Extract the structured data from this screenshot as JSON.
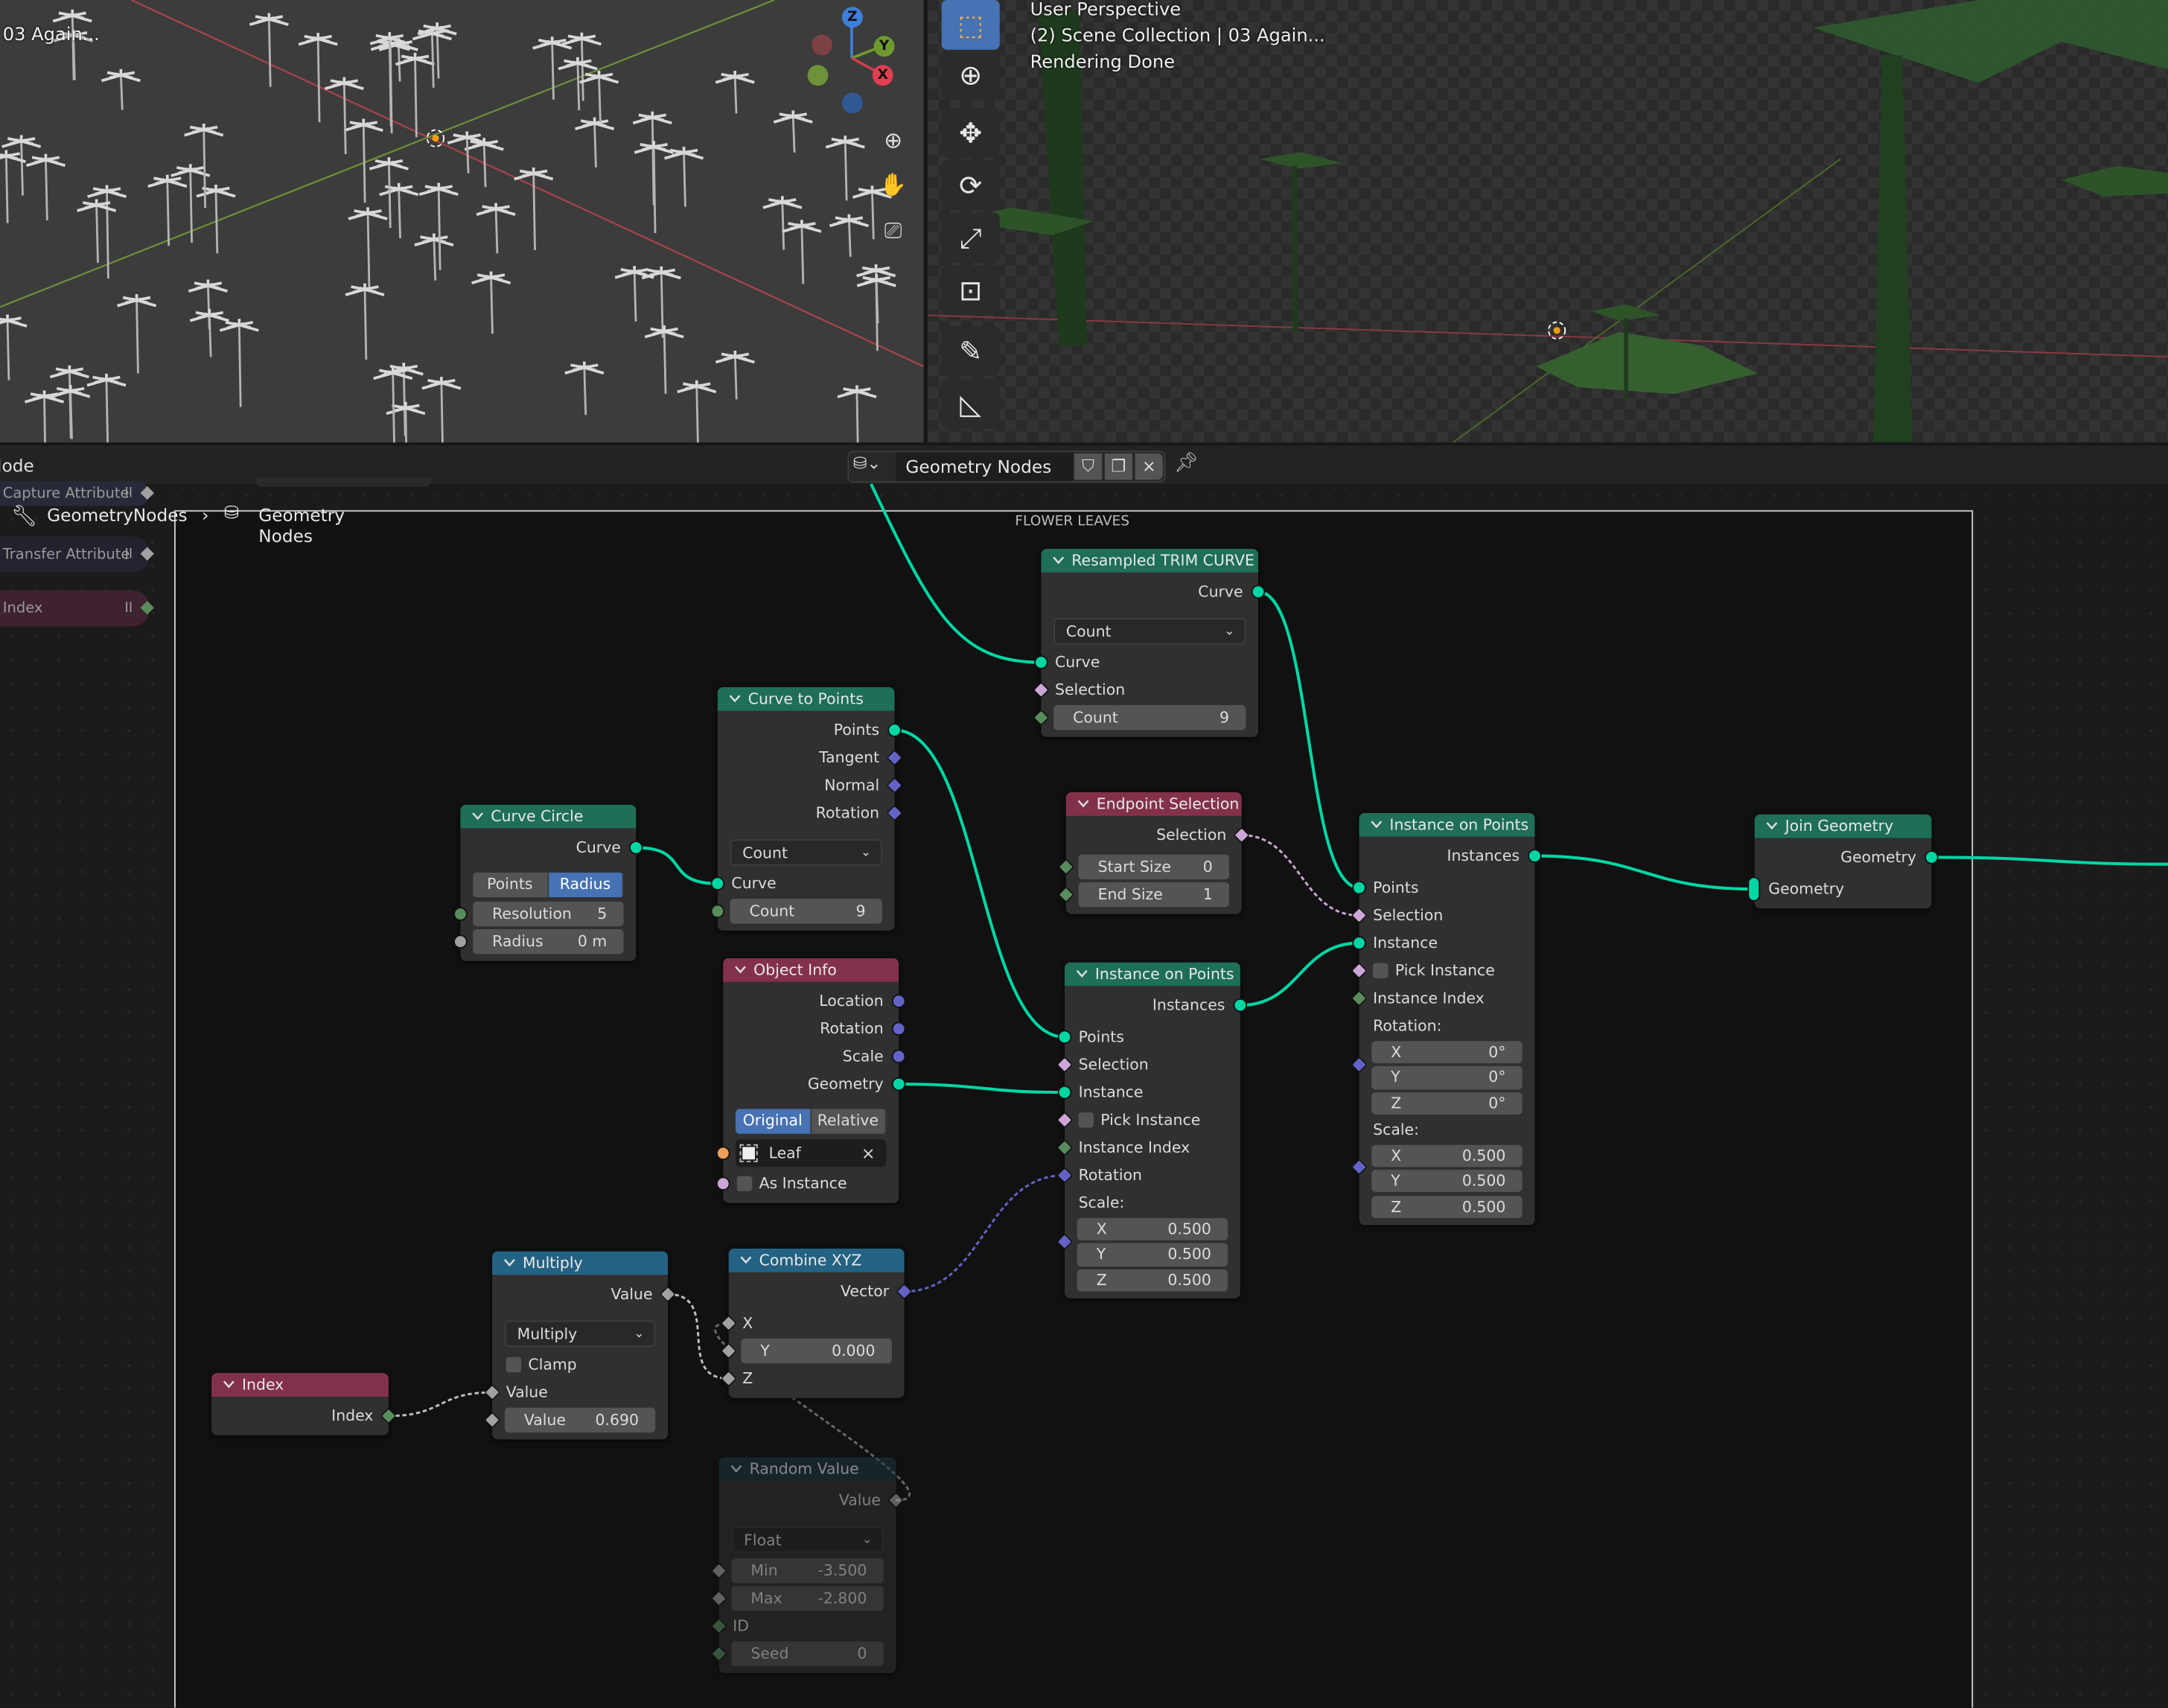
{
  "viewport_left": {
    "title": "03 Again...",
    "gizmo": {
      "x": "X",
      "y": "Y",
      "z": "Z"
    },
    "nav": [
      "zoom-icon",
      "hand-icon",
      "camera-icon"
    ]
  },
  "viewport_right": {
    "overlay_lines": [
      "User Perspective",
      "(2) Scene Collection | 03 Again...",
      "Rendering Done"
    ],
    "toolbar": [
      {
        "name": "select-box",
        "glyph": "⬚",
        "active": true
      },
      {
        "name": "cursor",
        "glyph": "⊕"
      },
      {
        "name": "move",
        "glyph": "✥"
      },
      {
        "name": "rotate",
        "glyph": "⟳"
      },
      {
        "name": "scale",
        "glyph": "⤢"
      },
      {
        "name": "transform",
        "glyph": "⊡"
      },
      {
        "name": "annotate",
        "glyph": "✎"
      },
      {
        "name": "measure",
        "glyph": "◺"
      }
    ]
  },
  "node_editor": {
    "header": {
      "menu": "Node",
      "tree_name": "Geometry Nodes",
      "close": "×"
    },
    "breadcrumb": {
      "modifier": "GeometryNodes",
      "separator": "›",
      "tree": "Geometry Nodes"
    },
    "frame_label": "FLOWER LEAVES",
    "side_nodes": [
      {
        "label": "Capture Attribute",
        "hidden": "II",
        "sock": "float"
      },
      {
        "label": "Transfer Attribute",
        "hidden": "II",
        "sock": "float"
      },
      {
        "label": "Index",
        "hidden": "II",
        "sock": "int"
      }
    ],
    "nodes": [
      {
        "id": "resample",
        "title": "Resampled TRIM CURVE",
        "category": "geometry",
        "rows": [
          {
            "t": "out",
            "label": "Curve",
            "sock": "geometry"
          },
          {
            "t": "dropdown",
            "value": "Count"
          },
          {
            "t": "in",
            "label": "Curve",
            "sock": "geometry"
          },
          {
            "t": "in",
            "label": "Selection",
            "sock": "bool",
            "shape": "diamond"
          },
          {
            "t": "field",
            "label": "Count",
            "value": "9",
            "sock": "int",
            "shape": "diamond"
          }
        ]
      },
      {
        "id": "c2p",
        "title": "Curve to Points",
        "category": "geometry",
        "rows": [
          {
            "t": "out",
            "label": "Points",
            "sock": "geometry"
          },
          {
            "t": "out",
            "label": "Tangent",
            "sock": "vector",
            "shape": "diamond"
          },
          {
            "t": "out",
            "label": "Normal",
            "sock": "vector",
            "shape": "diamond"
          },
          {
            "t": "out",
            "label": "Rotation",
            "sock": "vector",
            "shape": "diamond"
          },
          {
            "t": "dropdown",
            "value": "Count"
          },
          {
            "t": "in",
            "label": "Curve",
            "sock": "geometry"
          },
          {
            "t": "field",
            "label": "Count",
            "value": "9",
            "sock": "int"
          }
        ]
      },
      {
        "id": "circle",
        "title": "Curve Circle",
        "category": "geometry",
        "rows": [
          {
            "t": "out",
            "label": "Curve",
            "sock": "geometry"
          },
          {
            "t": "toggle",
            "options": [
              "Points",
              "Radius"
            ],
            "active": 1
          },
          {
            "t": "field",
            "label": "Resolution",
            "value": "5",
            "sock": "int"
          },
          {
            "t": "field",
            "label": "Radius",
            "value": "0 m",
            "sock": "float"
          }
        ]
      },
      {
        "id": "endsel",
        "title": "Endpoint Selection",
        "category": "input",
        "rows": [
          {
            "t": "out",
            "label": "Selection",
            "sock": "bool",
            "shape": "diamond"
          },
          {
            "t": "field",
            "label": "Start Size",
            "value": "0",
            "sock": "int",
            "shape": "diamond"
          },
          {
            "t": "field",
            "label": "End Size",
            "value": "1",
            "sock": "int",
            "shape": "diamond"
          }
        ]
      },
      {
        "id": "objinfo",
        "title": "Object Info",
        "category": "input",
        "rows": [
          {
            "t": "out",
            "label": "Location",
            "sock": "vector"
          },
          {
            "t": "out",
            "label": "Rotation",
            "sock": "vector"
          },
          {
            "t": "out",
            "label": "Scale",
            "sock": "vector"
          },
          {
            "t": "out",
            "label": "Geometry",
            "sock": "geometry"
          },
          {
            "t": "toggle",
            "options": [
              "Original",
              "Relative"
            ],
            "active": 0
          },
          {
            "t": "object",
            "value": "Leaf",
            "sock": "object"
          },
          {
            "t": "check",
            "label": "As Instance",
            "sock": "bool",
            "checked": false
          }
        ]
      },
      {
        "id": "iop1",
        "title": "Instance on Points",
        "category": "geometry",
        "rows": [
          {
            "t": "out",
            "label": "Instances",
            "sock": "geometry"
          },
          {
            "t": "in",
            "label": "Points",
            "sock": "geometry"
          },
          {
            "t": "in",
            "label": "Selection",
            "sock": "bool",
            "shape": "diamond"
          },
          {
            "t": "in",
            "label": "Instance",
            "sock": "geometry"
          },
          {
            "t": "check",
            "label": "Pick Instance",
            "sock": "bool",
            "shape": "diamond",
            "checked": false
          },
          {
            "t": "in",
            "label": "Instance Index",
            "sock": "int",
            "shape": "diamond"
          },
          {
            "t": "in",
            "label": "Rotation",
            "sock": "vector",
            "shape": "diamond"
          },
          {
            "t": "label",
            "label": "Scale:",
            "sock": "vector",
            "shape": "diamond"
          },
          {
            "t": "vfield",
            "label": "X",
            "value": "0.500"
          },
          {
            "t": "vfield",
            "label": "Y",
            "value": "0.500"
          },
          {
            "t": "vfield",
            "label": "Z",
            "value": "0.500"
          }
        ]
      },
      {
        "id": "iop2",
        "title": "Instance on Points",
        "category": "geometry",
        "rows": [
          {
            "t": "out",
            "label": "Instances",
            "sock": "geometry"
          },
          {
            "t": "in",
            "label": "Points",
            "sock": "geometry"
          },
          {
            "t": "in",
            "label": "Selection",
            "sock": "bool",
            "shape": "diamond"
          },
          {
            "t": "in",
            "label": "Instance",
            "sock": "geometry"
          },
          {
            "t": "check",
            "label": "Pick Instance",
            "sock": "bool",
            "shape": "diamond",
            "checked": false
          },
          {
            "t": "in",
            "label": "Instance Index",
            "sock": "int",
            "shape": "diamond"
          },
          {
            "t": "label",
            "label": "Rotation:",
            "sock": "vector",
            "shape": "diamond"
          },
          {
            "t": "vfield",
            "label": "X",
            "value": "0°"
          },
          {
            "t": "vfield",
            "label": "Y",
            "value": "0°"
          },
          {
            "t": "vfield",
            "label": "Z",
            "value": "0°"
          },
          {
            "t": "label",
            "label": "Scale:",
            "sock": "vector",
            "shape": "diamond"
          },
          {
            "t": "vfield",
            "label": "X",
            "value": "0.500"
          },
          {
            "t": "vfield",
            "label": "Y",
            "value": "0.500"
          },
          {
            "t": "vfield",
            "label": "Z",
            "value": "0.500"
          }
        ]
      },
      {
        "id": "join",
        "title": "Join Geometry",
        "category": "geometry",
        "rows": [
          {
            "t": "out",
            "label": "Geometry",
            "sock": "geometry"
          },
          {
            "t": "in",
            "label": "Geometry",
            "sock": "geometry",
            "shape": "multi"
          }
        ]
      },
      {
        "id": "mult",
        "title": "Multiply",
        "category": "utility",
        "rows": [
          {
            "t": "out",
            "label": "Value",
            "sock": "float",
            "shape": "diamond"
          },
          {
            "t": "dropdown",
            "value": "Multiply"
          },
          {
            "t": "check",
            "label": "Clamp",
            "checked": false
          },
          {
            "t": "in",
            "label": "Value",
            "sock": "float",
            "shape": "diamond"
          },
          {
            "t": "field",
            "label": "Value",
            "value": "0.690",
            "sock": "float",
            "shape": "diamond"
          }
        ]
      },
      {
        "id": "comb",
        "title": "Combine XYZ",
        "category": "utility",
        "rows": [
          {
            "t": "out",
            "label": "Vector",
            "sock": "vector",
            "shape": "diamond"
          },
          {
            "t": "in",
            "label": "X",
            "sock": "float",
            "shape": "diamond"
          },
          {
            "t": "field",
            "label": "Y",
            "value": "0.000",
            "sock": "float",
            "shape": "diamond"
          },
          {
            "t": "in",
            "label": "Z",
            "sock": "float",
            "shape": "diamond"
          }
        ]
      },
      {
        "id": "index",
        "title": "Index",
        "category": "input",
        "rows": [
          {
            "t": "out",
            "label": "Index",
            "sock": "int",
            "shape": "diamond"
          }
        ]
      },
      {
        "id": "rand",
        "title": "Random Value",
        "category": "random",
        "muted": true,
        "rows": [
          {
            "t": "out",
            "label": "Value",
            "sock": "float",
            "shape": "diamond"
          },
          {
            "t": "dropdown",
            "value": "Float"
          },
          {
            "t": "field",
            "label": "Min",
            "value": "-3.500",
            "sock": "float",
            "shape": "diamond"
          },
          {
            "t": "field",
            "label": "Max",
            "value": "-2.800",
            "sock": "float",
            "shape": "diamond"
          },
          {
            "t": "in",
            "label": "ID",
            "sock": "int",
            "shape": "diamond"
          },
          {
            "t": "field",
            "label": "Seed",
            "value": "0",
            "sock": "int",
            "shape": "diamond"
          }
        ]
      }
    ],
    "links": [
      {
        "from": "group_input",
        "to": "resample.2",
        "type": "geometry"
      },
      {
        "from": "resample.0",
        "to": "iop2.1",
        "type": "geometry"
      },
      {
        "from": "circle.0",
        "to": "c2p.5",
        "type": "geometry"
      },
      {
        "from": "c2p.0",
        "to": "iop1.1",
        "type": "geometry"
      },
      {
        "from": "endsel.0",
        "to": "iop2.2",
        "type": "bool",
        "dashed": true
      },
      {
        "from": "objinfo.3",
        "to": "iop1.3",
        "type": "geometry"
      },
      {
        "from": "iop1.0",
        "to": "iop2.3",
        "type": "geometry"
      },
      {
        "from": "iop2.0",
        "to": "join.1",
        "type": "geometry"
      },
      {
        "from": "join.0",
        "to": "group_output",
        "type": "geometry"
      },
      {
        "from": "comb.0",
        "to": "iop1.6",
        "type": "vector",
        "dashed": true
      },
      {
        "from": "mult.0",
        "to": "comb.3",
        "type": "float",
        "dashed": true
      },
      {
        "from": "index.0",
        "to": "mult.3",
        "type": "float",
        "dashed": true
      },
      {
        "from": "rand.0",
        "to": "comb.1",
        "type": "float",
        "dashed": true,
        "muted": true
      }
    ]
  },
  "colors": {
    "headers": {
      "geometry": "#1e6e58",
      "input": "#83314a",
      "utility": "#246283",
      "random": "#1d3642"
    },
    "sockets": {
      "geometry": "#00d6a3",
      "vector": "#6363c7",
      "float": "#a1a1a1",
      "int": "#598c5c",
      "bool": "#cca6d6",
      "object": "#ed9e5c"
    },
    "accent": "#4772b3",
    "axis_x": "#c8414f",
    "axis_y": "#6e9a2e",
    "axis_z": "#3d7fd9"
  }
}
